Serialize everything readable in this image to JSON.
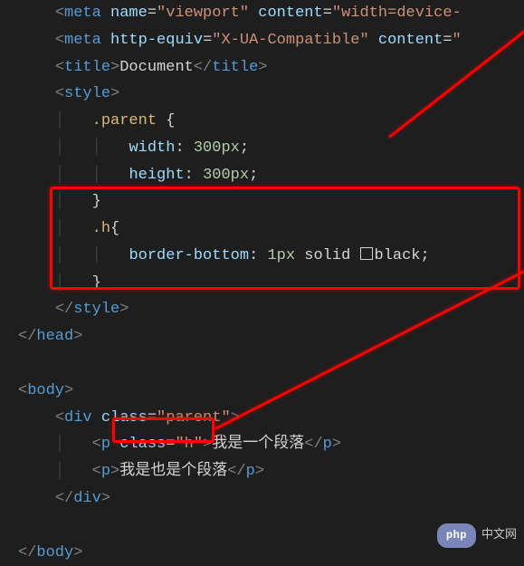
{
  "code": {
    "l1_tag": "meta",
    "l1_attr1": "name",
    "l1_val1": "viewport",
    "l1_attr2": "content",
    "l1_val2": "width=device-",
    "l2_tag": "meta",
    "l2_attr1": "http-equiv",
    "l2_val1": "X-UA-Compatible",
    "l2_attr2": "content",
    "l3_open": "title",
    "l3_text": "Document",
    "l3_close": "title",
    "l4_open": "style",
    "css_sel1": ".parent",
    "css_brace_open": "{",
    "css_brace_close": "}",
    "css_prop1": "width",
    "css_val1_num": "300",
    "css_val1_unit": "px",
    "css_prop2": "height",
    "css_val2_num": "300",
    "css_val2_unit": "px",
    "css_sel2": ".h",
    "css_prop3": "border-bottom",
    "css_val3_num": "1",
    "css_val3_unit": "px",
    "css_val3_kw": "solid",
    "css_val3_color": "black",
    "l_style_close": "style",
    "l_head_close": "head",
    "l_body_open": "body",
    "div_tag": "div",
    "div_attr": "class",
    "div_val": "parent",
    "p1_tag": "p",
    "p1_attr": "class",
    "p1_val": "h",
    "p1_text": "我是一个段落",
    "p1_close": "p",
    "p2_tag": "p",
    "p2_text": "我是也是个段落",
    "p2_close": "p",
    "div_close": "div",
    "l_body_close": "body"
  },
  "watermark": {
    "badge": "php",
    "text": "中文网"
  }
}
